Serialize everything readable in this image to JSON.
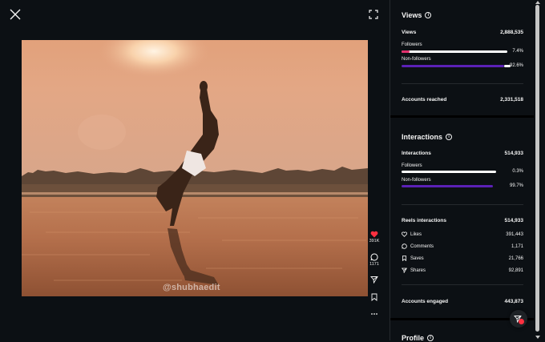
{
  "media": {
    "watermark": "@shubhaedit"
  },
  "actions": {
    "likes": "391K",
    "comments": "1171"
  },
  "views": {
    "title": "Views",
    "total_label": "Views",
    "total_value": "2,888,535",
    "followers_label": "Followers",
    "followers_pct": "7.4%",
    "followers_fraction": 0.074,
    "nonfollowers_label": "Non-followers",
    "nonfollowers_pct": "92.6%",
    "nonfollowers_fraction": 0.926,
    "reached_label": "Accounts reached",
    "reached_value": "2,331,518"
  },
  "interactions": {
    "title": "Interactions",
    "total_label": "Interactions",
    "total_value": "514,933",
    "followers_label": "Followers",
    "followers_pct": "0.3%",
    "followers_fraction": 0.003,
    "nonfollowers_label": "Non-followers",
    "nonfollowers_pct": "99.7%",
    "nonfollowers_fraction": 0.997,
    "reels_label": "Reels interactions",
    "reels_value": "514,933",
    "likes_label": "Likes",
    "likes_value": "391,443",
    "comments_label": "Comments",
    "comments_value": "1,171",
    "saves_label": "Saves",
    "saves_value": "21,766",
    "shares_label": "Shares",
    "shares_value": "92,891",
    "engaged_label": "Accounts engaged",
    "engaged_value": "443,873"
  },
  "profile": {
    "title": "Profile"
  },
  "colors": {
    "accent_pink": "#e1306c",
    "accent_purple": "#5b21b6",
    "bar_white": "#ffffff",
    "like_red": "#ff3040"
  }
}
